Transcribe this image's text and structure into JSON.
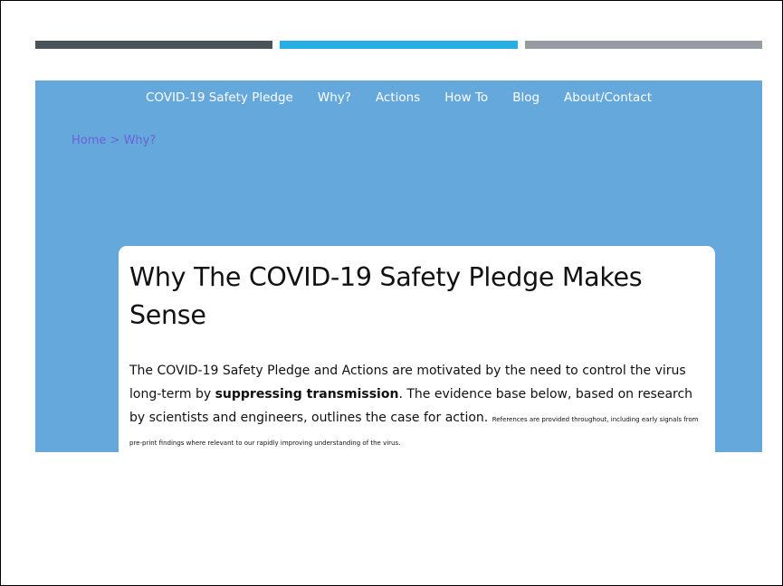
{
  "nav": {
    "items": [
      {
        "label": "COVID-19 Safety Pledge"
      },
      {
        "label": "Why?"
      },
      {
        "label": "Actions"
      },
      {
        "label": "How To"
      },
      {
        "label": "Blog"
      },
      {
        "label": "About/Contact"
      }
    ]
  },
  "breadcrumb": {
    "home": "Home",
    "separator": " > ",
    "current": "Why?"
  },
  "article": {
    "title": "Why The COVID-19 Safety Pledge Makes Sense",
    "lead_part1": "The COVID-19 Safety Pledge and Actions are motivated by the need to control the virus long-term by ",
    "lead_bold": "suppressing transmission",
    "lead_part2": ". The evidence base below, based on research by scientists and engineers, outlines the case for action. ",
    "lead_small": "References are provided throughout, including early signals from pre-print findings where relevant to our rapidly improving understanding of the virus."
  },
  "colors": {
    "bar1": "#4a5359",
    "bar2": "#27aee4",
    "bar3": "#969ca2",
    "page_background": "#65a9dc",
    "breadcrumb": "#6b61d8"
  }
}
